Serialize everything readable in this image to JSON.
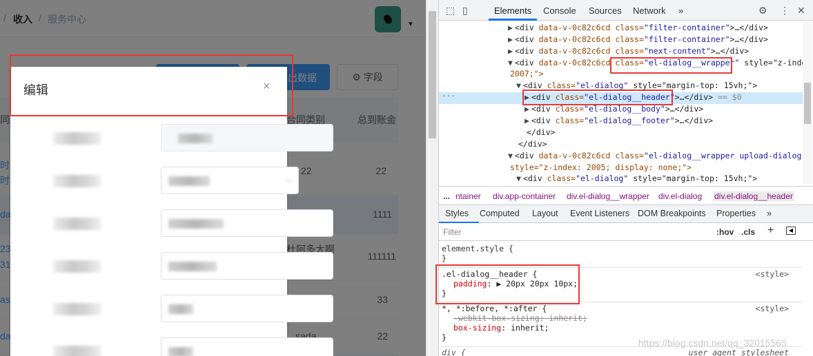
{
  "app": {
    "breadcrumb": {
      "sep1": "/",
      "item1": "收入",
      "sep2": "/",
      "item2": "服务中心"
    },
    "buttons": {
      "import_suffix": "出数据",
      "fields": "字段"
    },
    "table": {
      "headers": [
        "同编",
        "合同类别",
        "总到账金"
      ],
      "rows": [
        {
          "c1a": "时间",
          "c1b": "时",
          "c2": "22",
          "c3": "22"
        },
        {
          "c1a": "da",
          "c1b": "",
          "c2": "",
          "c3": "1111"
        },
        {
          "c1a": "23",
          "c1b": "31",
          "c2": "杜阿多大啊",
          "c3": "111111"
        },
        {
          "c1a": "asc",
          "c1b": "",
          "c2": "",
          "c3": "33"
        },
        {
          "c1a": "da",
          "c1b": "",
          "c2": "sada",
          "c3": "22"
        }
      ]
    }
  },
  "dialog": {
    "title": "编辑",
    "close": "×"
  },
  "devtools": {
    "tabs": [
      "Elements",
      "Console",
      "Sources",
      "Network"
    ],
    "more": "»",
    "elements": [
      {
        "tri": "▶",
        "tag": "<div ",
        "attr1": "data-v-0c82c6cd",
        "attr2": " class=",
        "val": "\"filter-container\"",
        "rest": ">…</div>"
      },
      {
        "tri": "▶",
        "tag": "<div ",
        "attr1": "data-v-0c82c6cd",
        "attr2": " class=",
        "val": "\"filter-container\"",
        "rest": ">…</div>"
      },
      {
        "tri": "▶",
        "tag": "<div ",
        "attr1": "data-v-0c82c6cd",
        "attr2": " class=",
        "val": "\"next-content\"",
        "rest": ">…</div>"
      },
      {
        "tri": "▼",
        "tag": "<div ",
        "attr1": "data-v-0c82c6cd",
        "attr2": " class=",
        "val": "\"el-dialog__wrapper\"",
        "rest": " style=\"z-index:"
      },
      {
        "tri": "",
        "tag": "",
        "attr1": "2007;\">",
        "attr2": "",
        "val": "",
        "rest": ""
      },
      {
        "tri": "▼",
        "tag": "<div ",
        "attr1": "class=",
        "attr2": "",
        "val": "\"el-dialog\"",
        "rest": " style=\"margin-top: 15vh;\">"
      },
      {
        "tri": "▶",
        "tag": "<div ",
        "attr1": "class=",
        "attr2": "",
        "val": "\"el-dialog__header\"",
        "rest": ">…</div>",
        "suffix": " == $0"
      },
      {
        "tri": "▶",
        "tag": "<div ",
        "attr1": "class=",
        "attr2": "",
        "val": "\"el-dialog__body\"",
        "rest": ">…</div>"
      },
      {
        "tri": "▶",
        "tag": "<div ",
        "attr1": "class=",
        "attr2": "",
        "val": "\"el-dialog__footer\"",
        "rest": ">…</div>"
      },
      {
        "tri": "",
        "tag": "</div>",
        "attr1": "",
        "attr2": "",
        "val": "",
        "rest": ""
      },
      {
        "tri": "",
        "tag": "</div>",
        "attr1": "",
        "attr2": "",
        "val": "",
        "rest": ""
      },
      {
        "tri": "▼",
        "tag": "<div ",
        "attr1": "data-v-0c82c6cd",
        "attr2": " class=",
        "val": "\"el-dialog__wrapper upload-dialog\"",
        "rest": ""
      },
      {
        "tri": "",
        "tag": "",
        "attr1": "style=\"z-index: 2005; display: none;\">",
        "attr2": "",
        "val": "",
        "rest": ""
      },
      {
        "tri": "▼",
        "tag": "<div ",
        "attr1": "class=",
        "attr2": "",
        "val": "\"el-dialog\"",
        "rest": " style=\"margin-top: 15vh;\">"
      }
    ],
    "dom_breadcrumb": [
      "...",
      "ntainer",
      "div.app-container",
      "div.el-dialog__wrapper",
      "div.el-dialog",
      "div.el-dialog__header"
    ],
    "style_tabs": [
      "Styles",
      "Computed",
      "Layout",
      "Event Listeners",
      "DOM Breakpoints",
      "Properties",
      "»"
    ],
    "filter": {
      "placeholder": "Filter",
      "hov": ":hov",
      "cls": ".cls",
      "plus": "+"
    },
    "rules": {
      "element_style": "element.style {",
      "close": "}",
      "header_selector": ".el-dialog__header {",
      "header_source": "<style>",
      "header_prop": "padding",
      "header_value": ": ▶ 20px 20px 10px;",
      "universal_selector": "*, *:before, *:after {",
      "universal_source": "<style>",
      "webkit_line": "-webkit-box-sizing: inherit;",
      "box_prop": "box-sizing",
      "box_value": ": inherit;",
      "div_selector": "div {",
      "div_source": "user agent stylesheet"
    }
  },
  "watermark": "https://blog.csdn.net/qq_32015565"
}
